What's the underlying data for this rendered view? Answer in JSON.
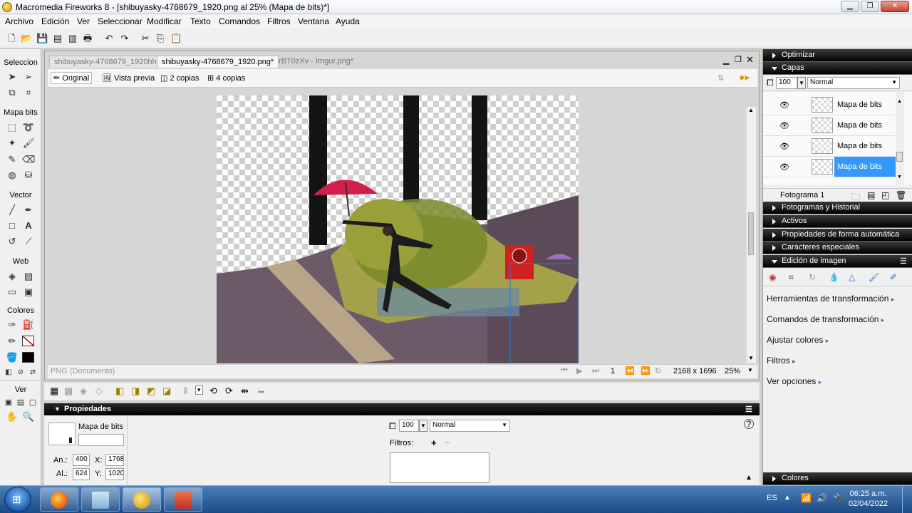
{
  "window": {
    "title": "Macromedia Fireworks 8 - [shibuyasky-4768679_1920.png al  25% (Mapa de bits)*]"
  },
  "menu": [
    "Archivo",
    "Edición",
    "Ver",
    "Seleccionar",
    "Modificar",
    "Texto",
    "Comandos",
    "Filtros",
    "Ventana",
    "Ayuda"
  ],
  "tools": {
    "seleccion": "Seleccion",
    "mapa_bits": "Mapa bits",
    "vector": "Vector",
    "web": "Web",
    "colores": "Colores",
    "ver": "Ver"
  },
  "doc_tabs": [
    "shibuyasky-4768679_1920hhj",
    "shibuyasky-4768679_1920.png*",
    "rBT0zXv - Imgur.png*"
  ],
  "view_buttons": {
    "original": "Original",
    "preview": "Vista previa",
    "two": "2 copias",
    "four": "4 copias"
  },
  "status": {
    "doc_type": "PNG (Documento)",
    "frame": "1",
    "size": "2168 x 1696",
    "zoom": "25%"
  },
  "right": {
    "optimizar": "Optimizar",
    "capas": "Capas",
    "opacity": "100",
    "blend": "Normal",
    "layers": [
      {
        "name": "Mapa de bits",
        "selected": false
      },
      {
        "name": "Mapa de bits",
        "selected": false
      },
      {
        "name": "Mapa de bits",
        "selected": false
      },
      {
        "name": "Mapa de bits",
        "selected": true
      }
    ],
    "frame_label": "Fotograma 1",
    "collapsed_panels": [
      "Fotogramas y Historial",
      "Activos",
      "Propiedades de forma automática",
      "Caracteres especiales"
    ],
    "edicion": "Edición de imagen",
    "edit_items": [
      "Herramientas de transformación",
      "Comandos de transformación",
      "Ajustar colores",
      "Filtros",
      "Ver opciones"
    ],
    "colores": "Colores"
  },
  "props": {
    "title": "Propiedades",
    "obj_name": "Mapa de bits",
    "an_label": "An.:",
    "an": "400",
    "al_label": "Al.:",
    "al": "624",
    "x_label": "X:",
    "x": "1768",
    "y_label": "Y:",
    "y": "1020",
    "opacity": "100",
    "blend": "Normal",
    "filtros": "Filtros:"
  },
  "taskbar": {
    "lang": "ES",
    "time": "06:25 a.m.",
    "date": "02/04/2022"
  }
}
